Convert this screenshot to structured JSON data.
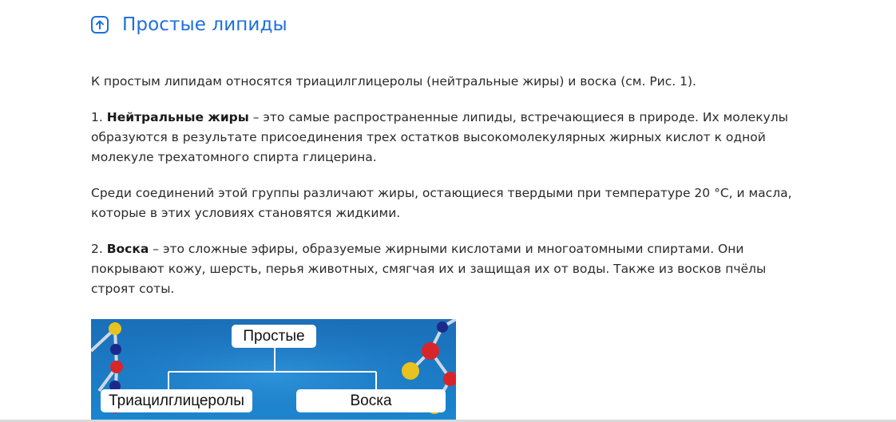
{
  "section": {
    "title": "Простые липиды",
    "icon": "link-arrow-up-icon"
  },
  "paragraphs": {
    "intro": "К простым липидам относятся триацилглицеролы (нейтральные жиры) и воска (см. Рис. 1).",
    "fats_num": "1. ",
    "fats_term": "Нейтральные жиры",
    "fats_text": " – это самые распространенные липиды, встречающиеся в природе. Их молекулы образуются в результате присоединения трех остатков высокомолекулярных жирных кислот к одной молекуле трехатомного спирта глицерина.",
    "fats_groups": "Среди соединений этой группы различают жиры, остающиеся твердыми при температуре 20 °С, и масла, которые в этих условиях становятся жидкими.",
    "wax_num": "2. ",
    "wax_term": "Воска",
    "wax_text": " – это сложные эфиры, образуемые жирными кислотами и многоатомными спиртами. Они покрывают кожу, шерсть, перья животных, смягчая их и защищая их от воды. Также из восков пчёлы строят соты."
  },
  "figure": {
    "root": "Простые",
    "left_child": "Триацилглицеролы",
    "right_child": "Воска",
    "colors": {
      "background_top": "#1b6fb8",
      "background_bottom": "#1a86d1",
      "box": "#ffffff",
      "lines": "#ffffff"
    }
  }
}
